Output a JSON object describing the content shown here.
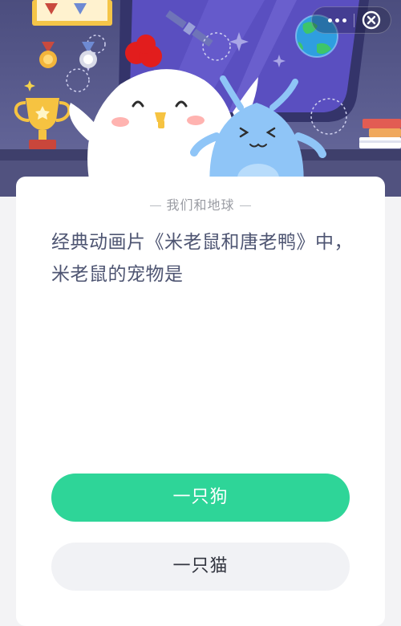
{
  "header": {
    "icons": [
      "trophy-icon",
      "medal-icon",
      "planet-icon",
      "books-icon",
      "satellite-icon"
    ],
    "characters": [
      "white-chick-mascot",
      "blue-alien-mascot"
    ],
    "menu": {
      "more_icon": "more-dots-icon",
      "close_icon": "close-icon"
    }
  },
  "quiz": {
    "topic": "我们和地球",
    "question": "经典动画片《米老鼠和唐老鸭》中，米老鼠的宠物是",
    "options": [
      {
        "label": "一只狗",
        "state": "highlighted"
      },
      {
        "label": "一只猫",
        "state": "default"
      }
    ]
  },
  "colors": {
    "header_bg": "#4b4d7e",
    "accent_green": "#2ed598",
    "option_gray": "#f1f2f5",
    "question_text": "#4e5572",
    "topic_text": "#9a9ca3"
  }
}
